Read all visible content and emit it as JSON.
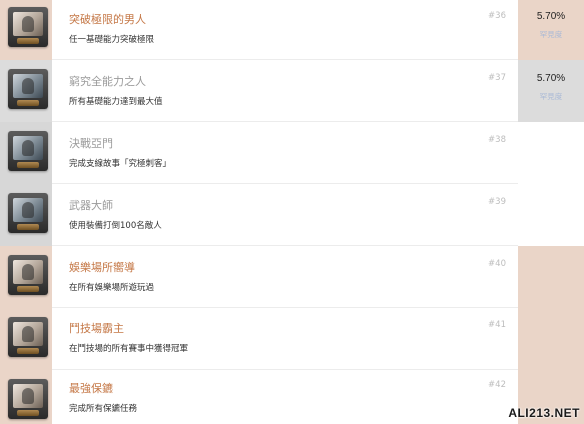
{
  "achievements": [
    {
      "title": "突破極限的男人",
      "description": "任一基礎能力突破極限",
      "number": "#36",
      "percent": "5.70%",
      "rarity_label": "罕見度"
    },
    {
      "title": "窮究全能力之人",
      "description": "所有基礎能力達到最大值",
      "number": "#37",
      "percent": "5.70%",
      "rarity_label": "罕見度"
    },
    {
      "title": "決戰亞門",
      "description": "完成支線故事「究極刺客」",
      "number": "#38"
    },
    {
      "title": "武器大師",
      "description": "使用裝備打倒100名敵人",
      "number": "#39"
    },
    {
      "title": "娛樂場所嚮導",
      "description": "在所有娛樂場所遊玩過",
      "number": "#40"
    },
    {
      "title": "鬥技場霸主",
      "description": "在鬥技場的所有賽事中獲得冠軍",
      "number": "#41"
    },
    {
      "title": "最強保鑣",
      "description": "完成所有保鑣任務",
      "number": "#42"
    }
  ],
  "watermark": "ALI213.NET",
  "colors": {
    "beige": "#ead5c8",
    "grey": "#dcdcdc",
    "title_orange": "#c57847",
    "title_grey": "#9a9a9a",
    "rarity_link": "#a9b9d6"
  }
}
